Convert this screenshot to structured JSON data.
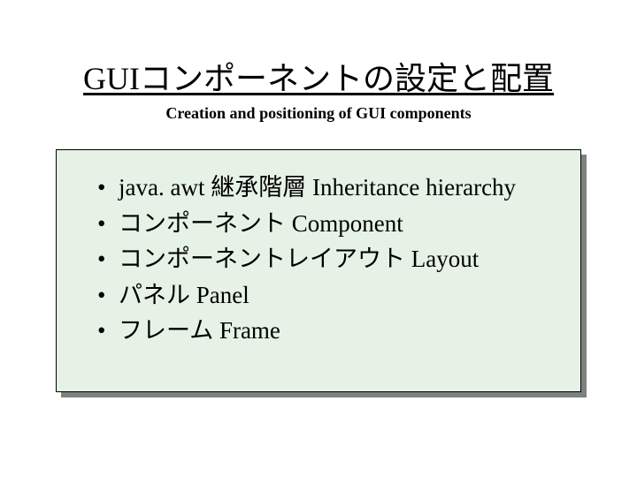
{
  "heading": "GUIコンポーネントの設定と配置",
  "subheading": "Creation and positioning of GUI components",
  "bullets": {
    "item0": "java. awt 継承階層 Inheritance hierarchy",
    "item1": "コンポーネント Component",
    "item2": "コンポーネントレイアウト Layout",
    "item3": "パネル Panel",
    "item4": "フレーム Frame"
  }
}
